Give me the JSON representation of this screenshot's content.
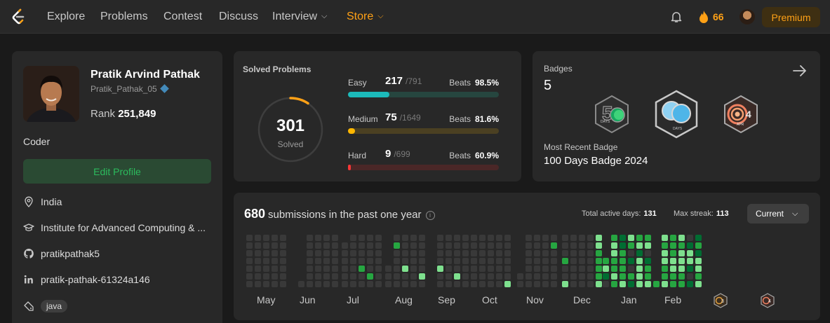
{
  "nav": {
    "items": [
      {
        "label": "Explore"
      },
      {
        "label": "Problems"
      },
      {
        "label": "Contest"
      },
      {
        "label": "Discuss"
      },
      {
        "label": "Interview"
      },
      {
        "label": "Store"
      }
    ],
    "streak_count": "66",
    "premium_label": "Premium",
    "colors": {
      "accent": "#ffa116",
      "background": "#282828"
    }
  },
  "profile": {
    "name": "Pratik Arvind Pathak",
    "handle": "Pratik_Pathak_05",
    "rank_label": "Rank",
    "rank_value": "251,849",
    "role": "Coder",
    "edit_label": "Edit Profile",
    "location": "India",
    "institute": "Institute for Advanced Computing & ...",
    "github": "pratikpathak5",
    "linkedin": "pratik-pathak-61324a146",
    "skill_tag": "java"
  },
  "solved": {
    "title": "Solved Problems",
    "total": "301",
    "total_label": "Solved",
    "difficulties": [
      {
        "label": "Easy",
        "solved": "217",
        "total": "/791",
        "beats_label": "Beats",
        "beats": "98.5%",
        "fraction": 0.274,
        "color": "#1cbaba",
        "track": "#26463f"
      },
      {
        "label": "Medium",
        "solved": "75",
        "total": "/1649",
        "beats_label": "Beats",
        "beats": "81.6%",
        "fraction": 0.045,
        "color": "#ffb700",
        "track": "#4b4022"
      },
      {
        "label": "Hard",
        "solved": "9",
        "total": "/699",
        "beats_label": "Beats",
        "beats": "60.9%",
        "fraction": 0.013,
        "color": "#f63737",
        "track": "#4a2727"
      }
    ]
  },
  "badges": {
    "label": "Badges",
    "count": "5",
    "items": [
      {
        "name": "50 days badge",
        "text": "DAYS"
      },
      {
        "name": "100 days badge",
        "text": "DAYS"
      },
      {
        "name": "april badge",
        "text": "APR",
        "number": "4"
      }
    ],
    "recent_label": "Most Recent Badge",
    "recent_name": "100 Days Badge 2024"
  },
  "submissions": {
    "count": "680",
    "text": "submissions in the past one year",
    "active_days_label": "Total active days:",
    "active_days": "131",
    "max_streak_label": "Max streak:",
    "max_streak": "113",
    "dropdown": "Current",
    "months": [
      "May",
      "Jun",
      "Jul",
      "Aug",
      "Sep",
      "Oct",
      "Nov",
      "Dec",
      "Jan",
      "Feb"
    ],
    "colors": {
      "empty": "#393939",
      "light": "#7ee08e",
      "mid": "#26a641",
      "dark": "#006d32"
    }
  }
}
